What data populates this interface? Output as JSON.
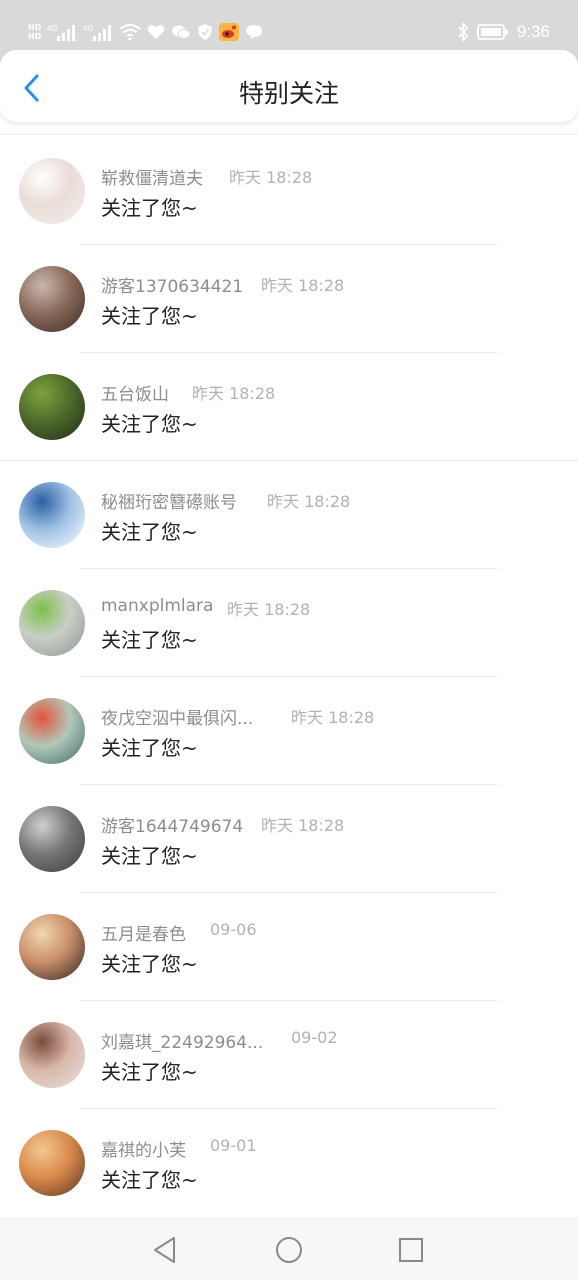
{
  "status_bar": {
    "time": "9:36",
    "left_icons": [
      "hd-icon",
      "signal-4g-icon",
      "signal-4g-icon",
      "wifi-icon",
      "health-icon",
      "wechat-icon",
      "shield-icon",
      "weibo-icon",
      "chat-bubble-icon"
    ],
    "right_icons": [
      "bluetooth-icon",
      "battery-icon"
    ],
    "hd_top": "HD",
    "hd_bottom": "HD",
    "net_label": "4G"
  },
  "header": {
    "title": "特别关注",
    "back_icon": "chevron-left-icon",
    "accent": "#2b8ef0"
  },
  "items": [
    {
      "name": "崭救僵清道夫",
      "time": "昨天 18:28",
      "message": "关注了您~",
      "avatar_colors": [
        "#f4f0ee",
        "#e9dcd6",
        "#ffffff"
      ]
    },
    {
      "name": "游客1370634421",
      "time": "昨天 18:28",
      "message": "关注了您~",
      "avatar_colors": [
        "#3a2a22",
        "#8b6a5c",
        "#c9b7ad"
      ]
    },
    {
      "name": "五台饭山",
      "time": "昨天 18:28",
      "message": "关注了您~",
      "avatar_colors": [
        "#1f2a1c",
        "#4f6b2c",
        "#7da33a"
      ]
    },
    {
      "name": "秘祵珩密簪礤账号",
      "time": "昨天 18:28",
      "message": "关注了您~",
      "avatar_colors": [
        "#ffffff",
        "#9fc1e4",
        "#2c5fa3"
      ]
    },
    {
      "name": "manxplmlara",
      "time": "昨天 18:28",
      "message": "关注了您~",
      "avatar_colors": [
        "#8e9293",
        "#c9cfc7",
        "#7ec04b"
      ]
    },
    {
      "name": "夜戊空泅中最俱闪...",
      "time": "昨天 18:28",
      "message": "关注了您~",
      "avatar_colors": [
        "#3f6a6e",
        "#b2c8b8",
        "#e2533b"
      ]
    },
    {
      "name": "游客1644749674",
      "time": "昨天 18:28",
      "message": "关注了您~",
      "avatar_colors": [
        "#3b3b3b",
        "#777777",
        "#cfcfcf"
      ]
    },
    {
      "name": "五月是春色",
      "time": "09-06",
      "message": "关注了您~",
      "avatar_colors": [
        "#2c2020",
        "#c98f6a",
        "#f2d7b0"
      ]
    },
    {
      "name": "刘嘉琪_22492964...",
      "time": "09-02",
      "message": "关注了您~",
      "avatar_colors": [
        "#e8e2de",
        "#d9b7aa",
        "#7a4b3a"
      ]
    },
    {
      "name": "嘉祺的小芙",
      "time": "09-01",
      "message": "关注了您~",
      "avatar_colors": [
        "#5a3420",
        "#d98a4c",
        "#f3c890"
      ]
    }
  ],
  "nav_bar": {
    "back_icon": "triangle-back-icon",
    "home_icon": "circle-home-icon",
    "recent_icon": "square-recents-icon"
  }
}
